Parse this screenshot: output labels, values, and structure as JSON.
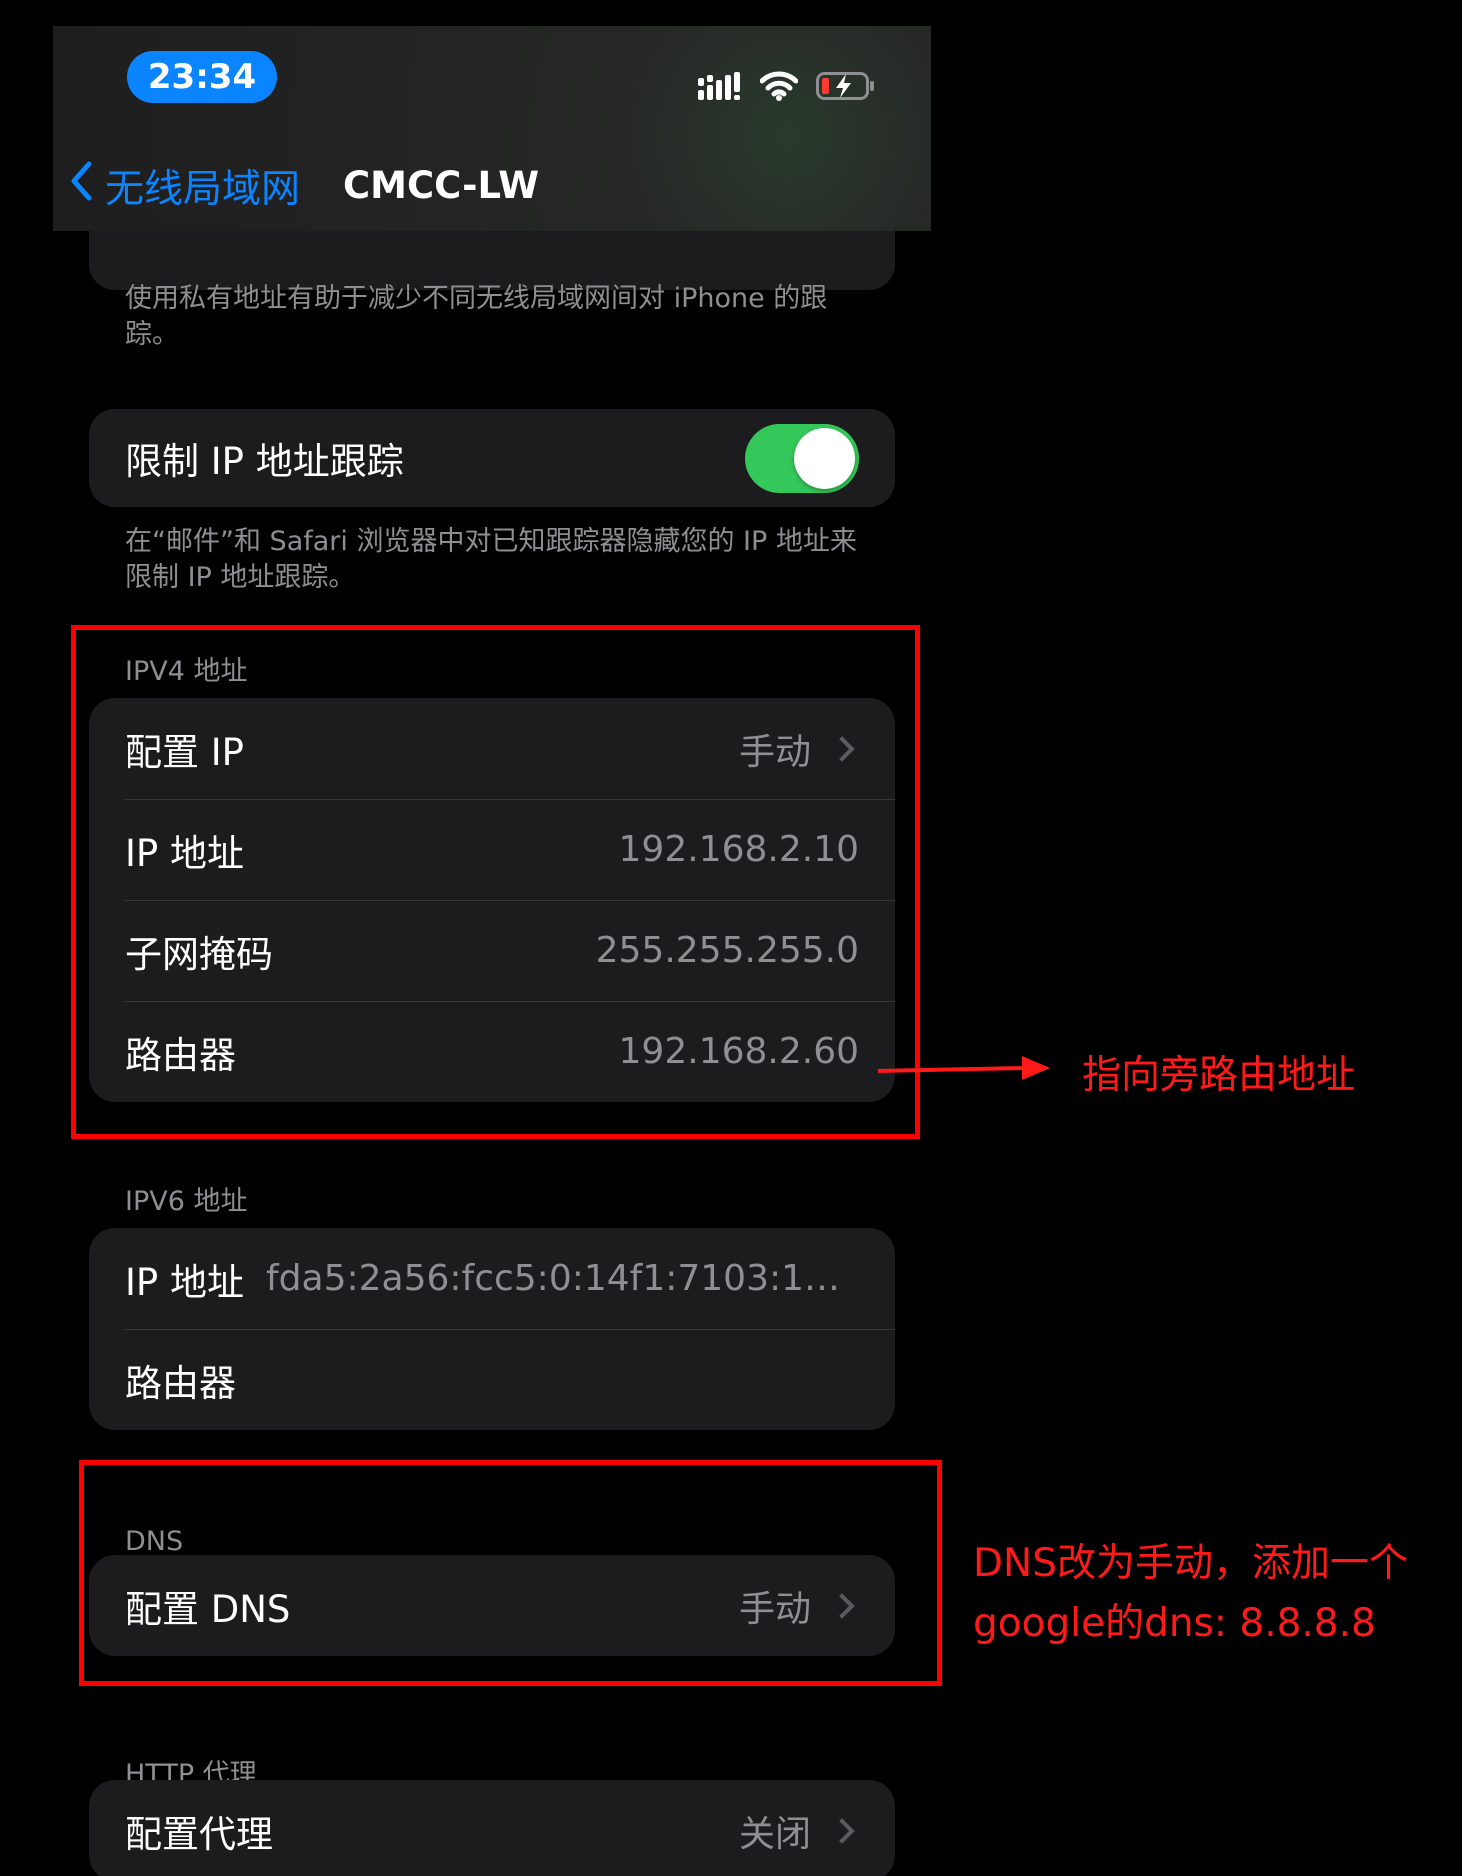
{
  "status_bar": {
    "time": "23:34",
    "icons": [
      "cellular-signal-icon",
      "wifi-icon",
      "battery-charging-icon"
    ]
  },
  "nav": {
    "back_label": "无线局域网",
    "title": "CMCC-LW"
  },
  "private_address": {
    "footer": "使用私有地址有助于减少不同无线局域网间对 iPhone 的跟踪。"
  },
  "limit_ip_tracking": {
    "label": "限制 IP 地址跟踪",
    "enabled": true,
    "footer": "在“邮件”和 Safari 浏览器中对已知跟踪器隐藏您的 IP 地址来限制 IP 地址跟踪。"
  },
  "ipv4": {
    "header": "IPV4 地址",
    "configure_label": "配置 IP",
    "configure_value": "手动",
    "ip_label": "IP 地址",
    "ip_value": "192.168.2.10",
    "subnet_label": "子网掩码",
    "subnet_value": "255.255.255.0",
    "router_label": "路由器",
    "router_value": "192.168.2.60"
  },
  "ipv6": {
    "header": "IPV6 地址",
    "ip_label": "IP 地址",
    "ip_value": "fda5:2a56:fcc5:0:14f1:7103:1122:...",
    "router_label": "路由器"
  },
  "dns": {
    "header": "DNS",
    "configure_label": "配置 DNS",
    "configure_value": "手动"
  },
  "http_proxy": {
    "header": "HTTP 代理",
    "configure_label": "配置代理",
    "configure_value": "关闭"
  },
  "annotations": {
    "router_note": "指向旁路由地址",
    "dns_note_line1": "DNS改为手动，添加一个",
    "dns_note_line2": "google的dns: 8.8.8.8"
  },
  "colors": {
    "accent": "#0a84ff",
    "toggle_on": "#34c759",
    "annotation": "#ff0000",
    "cell_bg": "#1c1c1e"
  }
}
